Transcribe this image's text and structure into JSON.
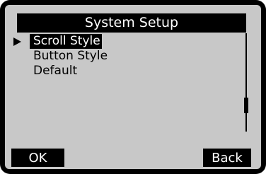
{
  "screen": {
    "title": "System Setup"
  },
  "menu": {
    "items": [
      {
        "label": "Scroll Style",
        "selected": true
      },
      {
        "label": "Button Style",
        "selected": false
      },
      {
        "label": "Default",
        "selected": false
      }
    ],
    "cursor_icon": "triangle-right-icon"
  },
  "scrollbar": {
    "position_fraction": 0.78
  },
  "softkeys": {
    "left_label": "OK",
    "right_label": "Back"
  },
  "colors": {
    "bezel": "#000000",
    "screen_background": "#c8c8c8",
    "highlight": "#000000",
    "highlight_text": "#ffffff"
  }
}
